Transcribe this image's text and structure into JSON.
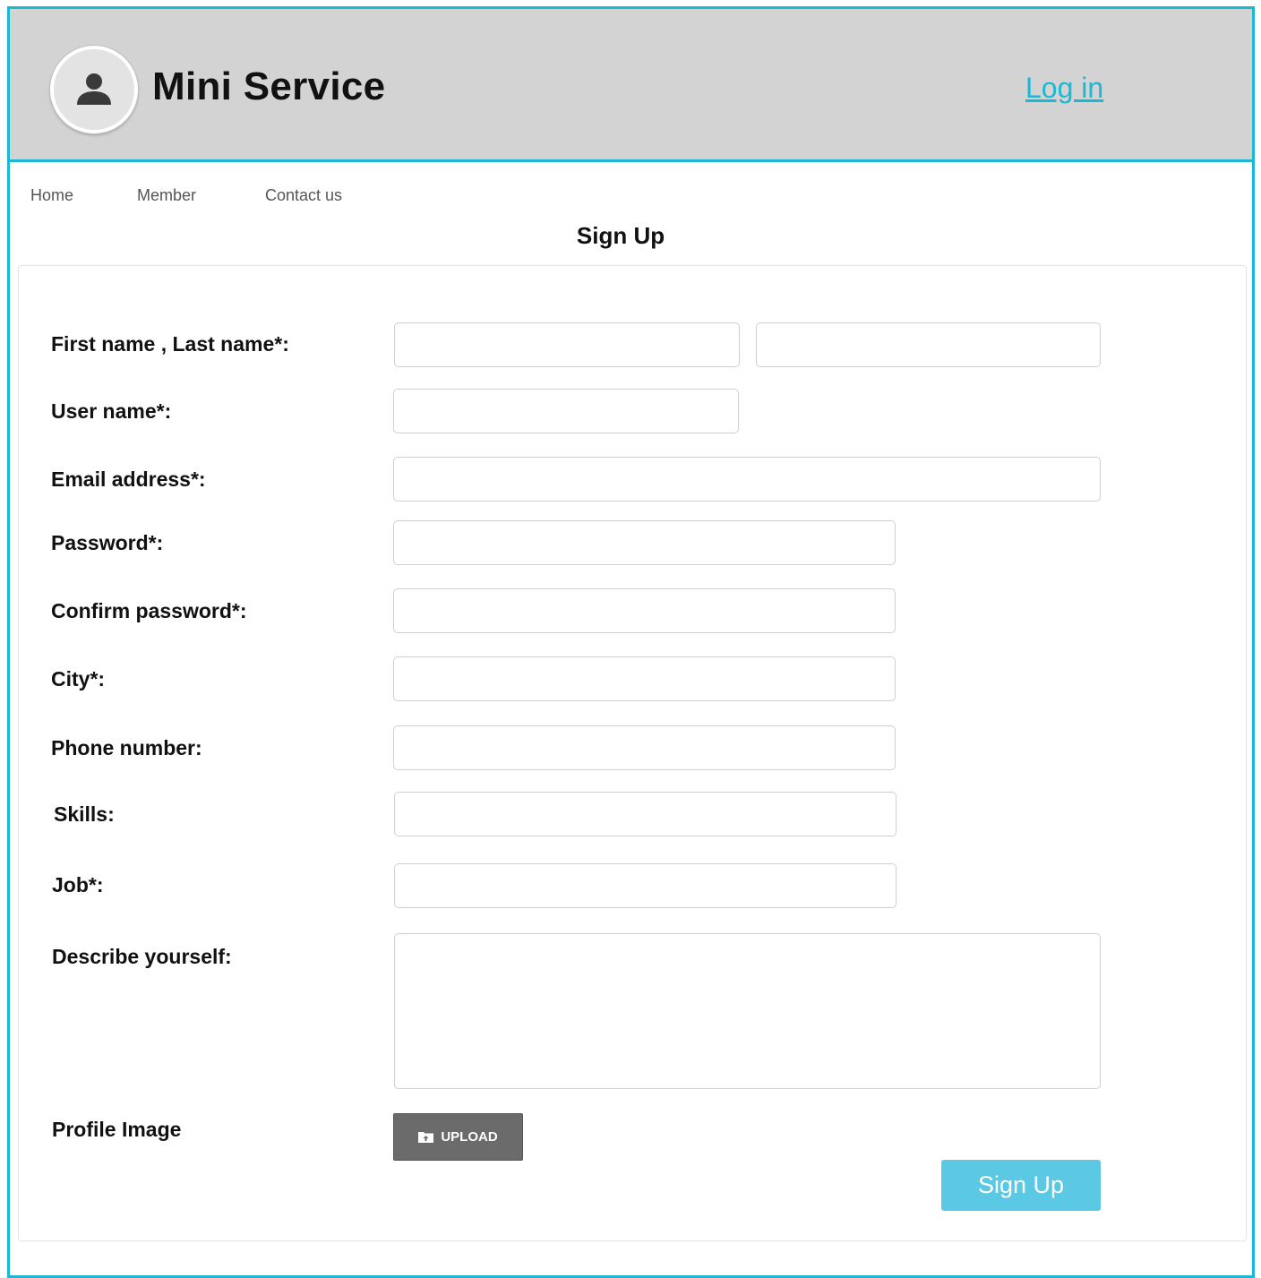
{
  "header": {
    "brand": "Mini Service",
    "login_label": "Log in",
    "avatar_icon": "user-icon",
    "background": "#d3d3d3",
    "accent": "#1cb8d3"
  },
  "nav": {
    "items": [
      {
        "label": "Home"
      },
      {
        "label": "Member"
      },
      {
        "label": "Contact us"
      }
    ]
  },
  "form": {
    "title": "Sign Up",
    "labels": {
      "name": "First name , Last name*:",
      "username": "User name*:",
      "email": "Email address*:",
      "password": "Password*:",
      "confirm_password": "Confirm password*:",
      "city": "City*:",
      "phone": "Phone number:",
      "skills": "Skills:",
      "job": "Job*:",
      "describe": "Describe yourself:",
      "profile_image": "Profile Image"
    },
    "values": {
      "first_name": "",
      "last_name": "",
      "username": "",
      "email": "",
      "password": "",
      "confirm_password": "",
      "city": "",
      "phone": "",
      "skills": "",
      "job": "",
      "describe": ""
    },
    "upload_label": "UPLOAD",
    "upload_icon": "folder-upload-icon",
    "submit_label": "Sign Up",
    "submit_color": "#5bc8e4"
  }
}
